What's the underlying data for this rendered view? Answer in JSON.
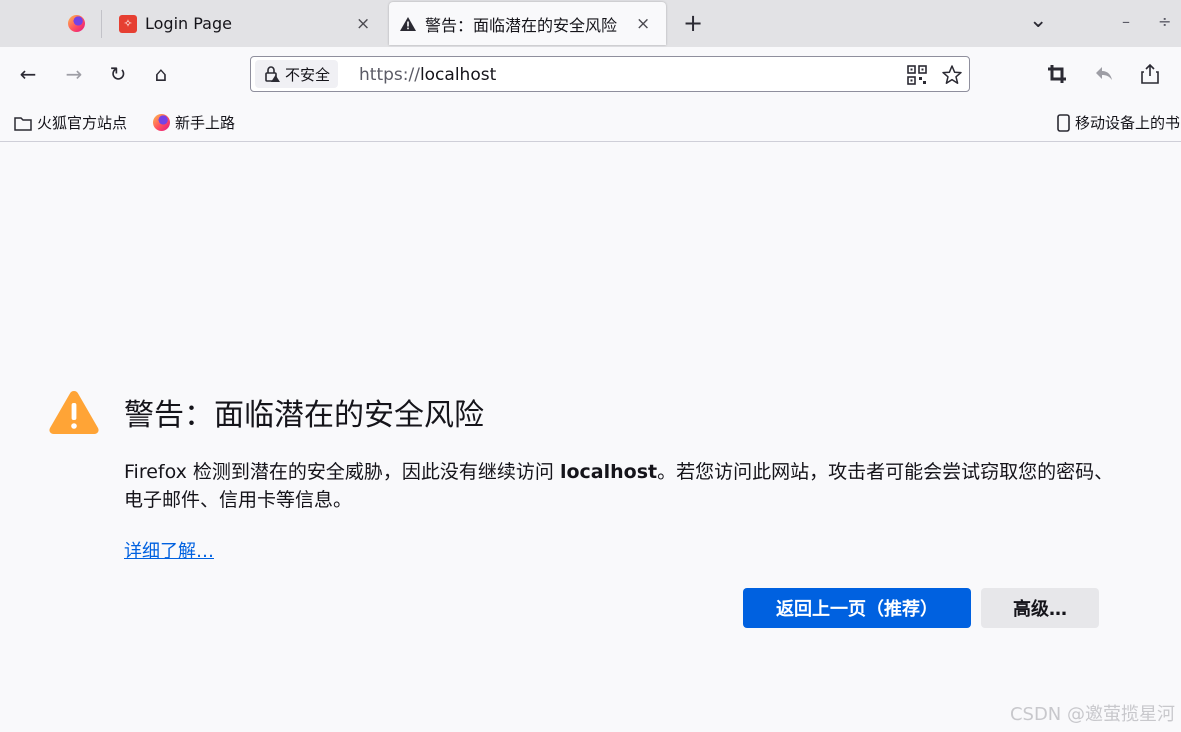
{
  "tabs": [
    {
      "label": "Login Page",
      "close": "×"
    },
    {
      "label": "警告：面临潜在的安全风险",
      "close": "×"
    }
  ],
  "tab_strip": {
    "new_tab": "+",
    "list_all": "⌄",
    "minimize": "–",
    "maximize": "÷"
  },
  "navbar": {
    "back": "←",
    "forward": "→",
    "reload": "↻",
    "home": "⌂",
    "security_label": "不安全",
    "url_scheme": "https://",
    "url_host": "localhost",
    "crop": "⌗",
    "reply": "↰",
    "share": "⇪"
  },
  "bookmarks": {
    "item1": "火狐官方站点",
    "item2": "新手上路",
    "right": "移动设备上的书"
  },
  "page": {
    "title": "警告：面临潜在的安全风险",
    "desc_before": "Firefox 检测到潜在的安全威胁，因此没有继续访问 ",
    "desc_host": "localhost",
    "desc_after": "。若您访问此网站，攻击者可能会尝试窃取您的密码、电子邮件、信用卡等信息。",
    "learn_more": "详细了解…",
    "back_button": "返回上一页（推荐）",
    "advanced_button": "高级…"
  },
  "watermark": "CSDN @邀萤揽星河",
  "colors": {
    "accent": "#0061e0",
    "warning": "#ffa436"
  }
}
